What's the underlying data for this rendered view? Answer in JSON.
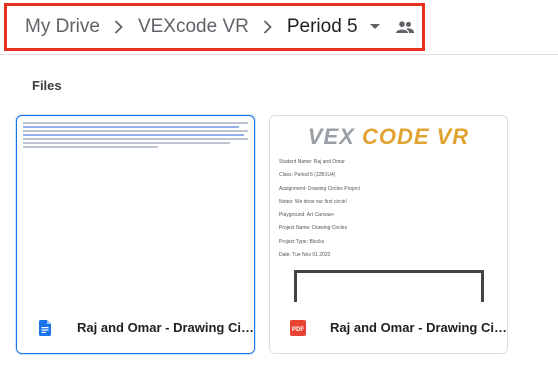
{
  "breadcrumb": {
    "items": [
      "My Drive",
      "VEXcode VR",
      "Period 5"
    ],
    "highlight_color": "#e8311f"
  },
  "section": {
    "title": "Files"
  },
  "files": [
    {
      "name": "Raj and Omar - Drawing Cir...",
      "type": "google-doc",
      "icon": "google-docs-icon",
      "icon_color": "#1a73e8",
      "selected": true
    },
    {
      "name": "Raj and Omar - Drawing Cir...",
      "type": "pdf",
      "icon": "pdf-icon",
      "icon_color": "#ea4335",
      "selected": false,
      "preview": {
        "logo_vex": "VEX",
        "logo_code": "CODE VR",
        "lines": [
          "Student Name: Raj and Omar",
          "Class: Period 5 (J2B1U4)",
          "Assignment: Drawing Circles Project",
          "Notes: We drew our first circle!",
          "Playground: Art Canvas+",
          "Project Name: Drawing Circles",
          "Project Type: Blocks",
          "Date: Tue Nov 01 2022"
        ]
      }
    }
  ]
}
